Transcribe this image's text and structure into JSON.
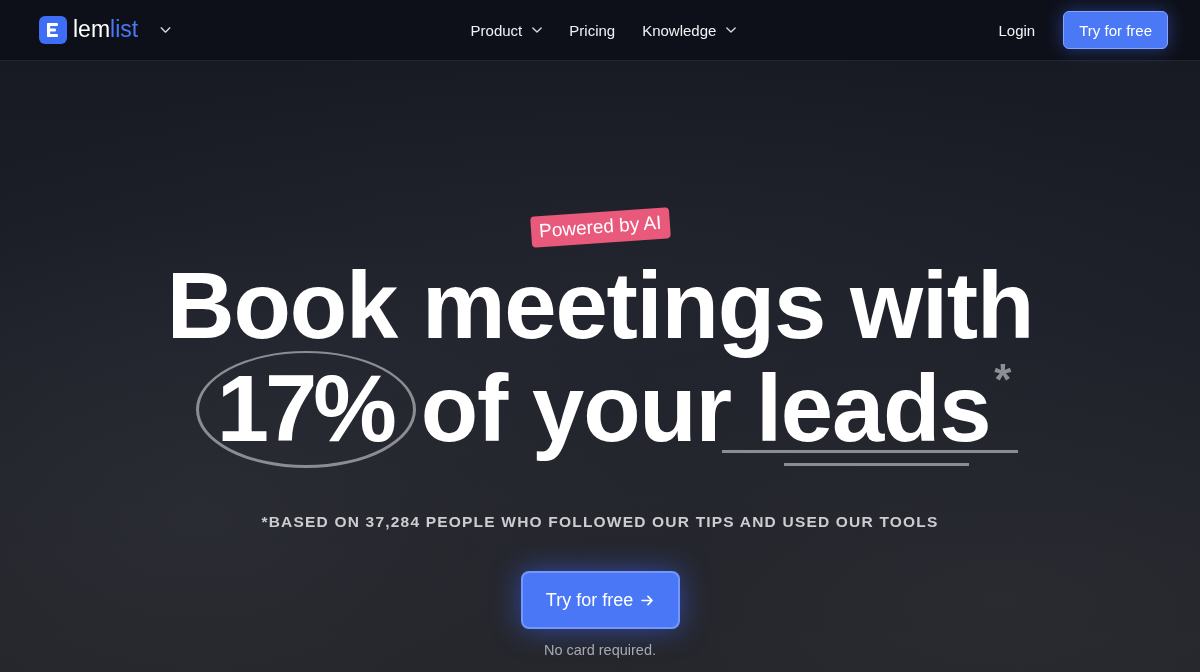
{
  "nav": {
    "logo": {
      "parts": [
        {
          "text": "lem",
          "color": "#ffffff"
        },
        {
          "text": "list",
          "color": "#4a78f5"
        }
      ]
    },
    "links": [
      {
        "label": "Product",
        "kind": "dropdown"
      },
      {
        "label": "Pricing",
        "kind": "link"
      },
      {
        "label": "Knowledge",
        "kind": "dropdown"
      }
    ],
    "login": "Login",
    "cta": "Try for free"
  },
  "hero": {
    "badge": "Powered by AI",
    "headline": {
      "line_1": "Book meetings with",
      "line_2": [
        {
          "text": "17%",
          "kind": "circled"
        },
        {
          "text": "of your",
          "kind": "plain"
        },
        {
          "text": "leads",
          "kind": "underlined"
        },
        {
          "text": "*",
          "kind": "footnote_mark"
        }
      ]
    },
    "footnote": "*BASED ON 37,284 PEOPLE WHO FOLLOWED OUR TIPS AND USED OUR TOOLS",
    "cta": "Try for free",
    "note": "No card required."
  }
}
